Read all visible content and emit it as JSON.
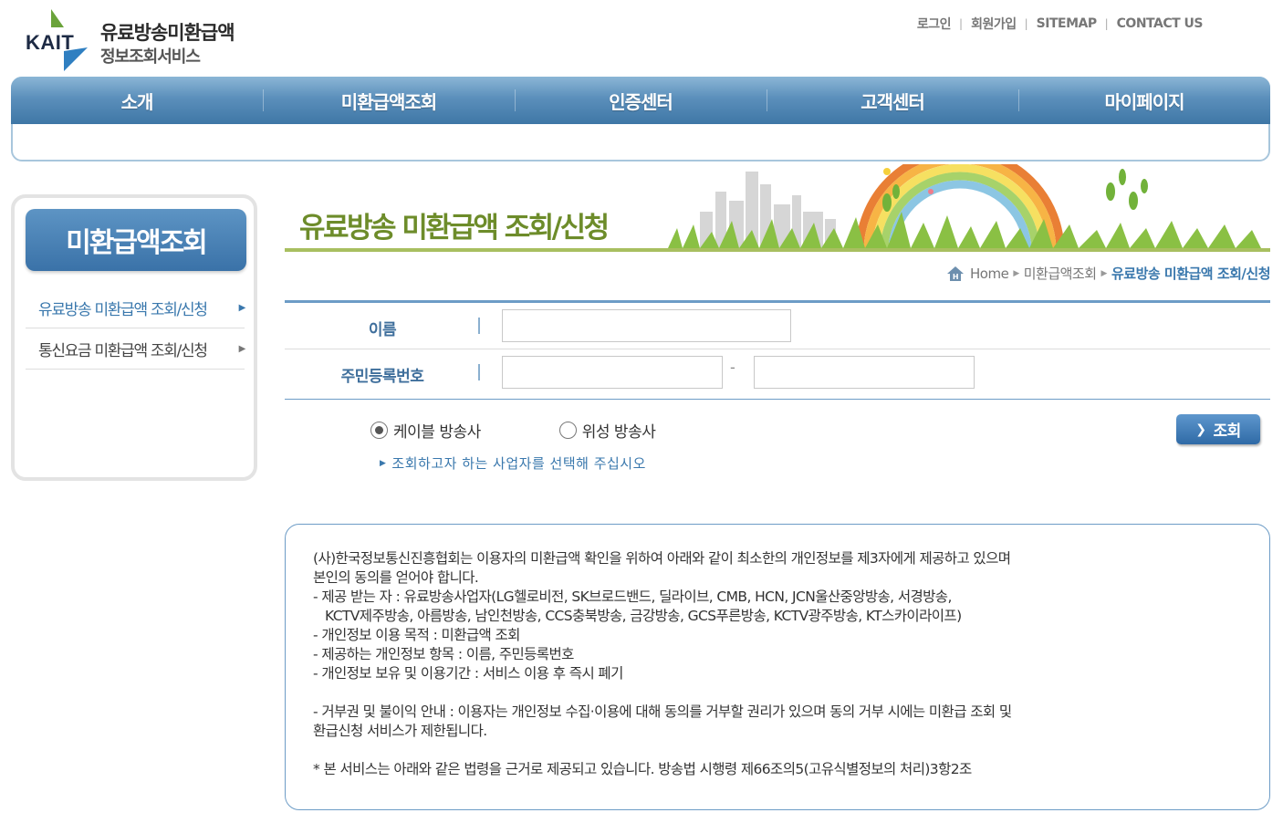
{
  "brand": {
    "mark": "KAIT",
    "title": "유료방송미환급액",
    "subtitle": "정보조회서비스"
  },
  "util_links": [
    "로그인",
    "회원가입",
    "SITEMAP",
    "CONTACT US"
  ],
  "gnb": [
    "소개",
    "미환급액조회",
    "인증센터",
    "고객센터",
    "마이페이지"
  ],
  "sidebar": {
    "title": "미환급액조회",
    "items": [
      {
        "label": "유료방송 미환급액 조회/신청"
      },
      {
        "label": "통신요금 미환급액 조회/신청"
      }
    ]
  },
  "banner": {
    "title": "유료방송 미환급액 조회/신청"
  },
  "breadcrumb": {
    "home": "Home",
    "level1": "미환급액조회",
    "current": "유료방송 미환급액 조회/신청"
  },
  "form": {
    "name_label": "이름",
    "name_value": "",
    "rrn_label": "주민등록번호",
    "rrn_first_value": "",
    "rrn_second_value": "",
    "dash": "-",
    "radio_cable": "케이블 방송사",
    "radio_satellite": "위성 방송사",
    "selected": "cable",
    "hint": "조회하고자 하는 사업자를 선택해 주십시오",
    "search_button": "조회"
  },
  "notice": {
    "lines": [
      "(사)한국정보통신진흥협회는 이용자의 미환급액 확인을 위하여 아래와 같이 최소한의 개인정보를 제3자에게 제공하고 있으며",
      "본인의 동의를 얻어야 합니다.",
      "- 제공 받는 자 : 유료방송사업자(LG헬로비전, SK브로드밴드, 딜라이브, CMB, HCN, JCN울산중앙방송, 서경방송,",
      "   KCTV제주방송, 아름방송, 남인천방송, CCS충북방송, 금강방송, GCS푸른방송, KCTV광주방송, KT스카이라이프)",
      "- 개인정보 이용 목적 : 미환급액 조회",
      "- 제공하는 개인정보 항목 : 이름, 주민등록번호",
      "- 개인정보 보유 및 이용기간 : 서비스 이용 후 즉시 폐기",
      "",
      "- 거부권 및 불이익 안내 : 이용자는 개인정보 수집·이용에 대해 동의를 거부할 권리가 있으며 동의 거부 시에는 미환급 조회 및",
      "환급신청 서비스가 제한됩니다.",
      "",
      "* 본 서비스는 아래와 같은 법령을 근거로 제공되고 있습니다. 방송법 시행령 제66조의5(고유식별정보의 처리)3항2조"
    ]
  },
  "colors": {
    "accent": "#3a78ad",
    "nav_blue": "#3f77a6",
    "banner_green": "#6d8c2a",
    "line_green": "#a8bf60"
  }
}
